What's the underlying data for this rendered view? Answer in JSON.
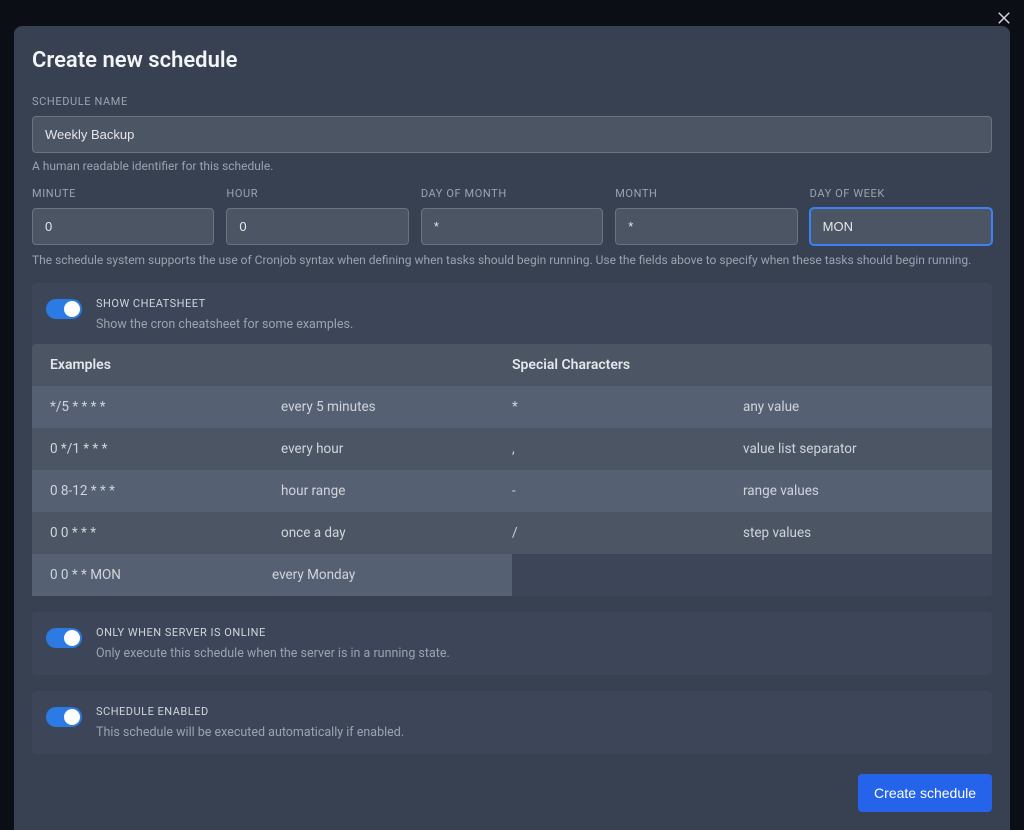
{
  "modal": {
    "title": "Create new schedule",
    "close_icon": "close-icon"
  },
  "name_field": {
    "label": "SCHEDULE NAME",
    "value": "Weekly Backup",
    "help": "A human readable identifier for this schedule."
  },
  "cron": {
    "minute_label": "MINUTE",
    "minute_value": "0",
    "hour_label": "HOUR",
    "hour_value": "0",
    "dom_label": "DAY OF MONTH",
    "dom_value": "*",
    "month_label": "MONTH",
    "month_value": "*",
    "dow_label": "DAY OF WEEK",
    "dow_value": "MON",
    "help": "The schedule system supports the use of Cronjob syntax when defining when tasks should begin running. Use the fields above to specify when these tasks should begin running."
  },
  "cheatsheet_toggle": {
    "label": "SHOW CHEATSHEET",
    "desc": "Show the cron cheatsheet for some examples."
  },
  "cheatsheet": {
    "header_examples": "Examples",
    "header_special": "Special Characters",
    "rows": [
      {
        "expr": "*/5 * * * *",
        "meaning": "every 5 minutes",
        "char": "*",
        "char_meaning": "any value"
      },
      {
        "expr": "0 */1 * * *",
        "meaning": "every hour",
        "char": ",",
        "char_meaning": "value list separator"
      },
      {
        "expr": "0 8-12 * * *",
        "meaning": "hour range",
        "char": "-",
        "char_meaning": "range values"
      },
      {
        "expr": "0 0 * * *",
        "meaning": "once a day",
        "char": "/",
        "char_meaning": "step values"
      },
      {
        "expr": "0 0 * * MON",
        "meaning": "every Monday"
      }
    ]
  },
  "online_toggle": {
    "label": "ONLY WHEN SERVER IS ONLINE",
    "desc": "Only execute this schedule when the server is in a running state."
  },
  "enabled_toggle": {
    "label": "SCHEDULE ENABLED",
    "desc": "This schedule will be executed automatically if enabled."
  },
  "footer": {
    "submit": "Create schedule"
  }
}
